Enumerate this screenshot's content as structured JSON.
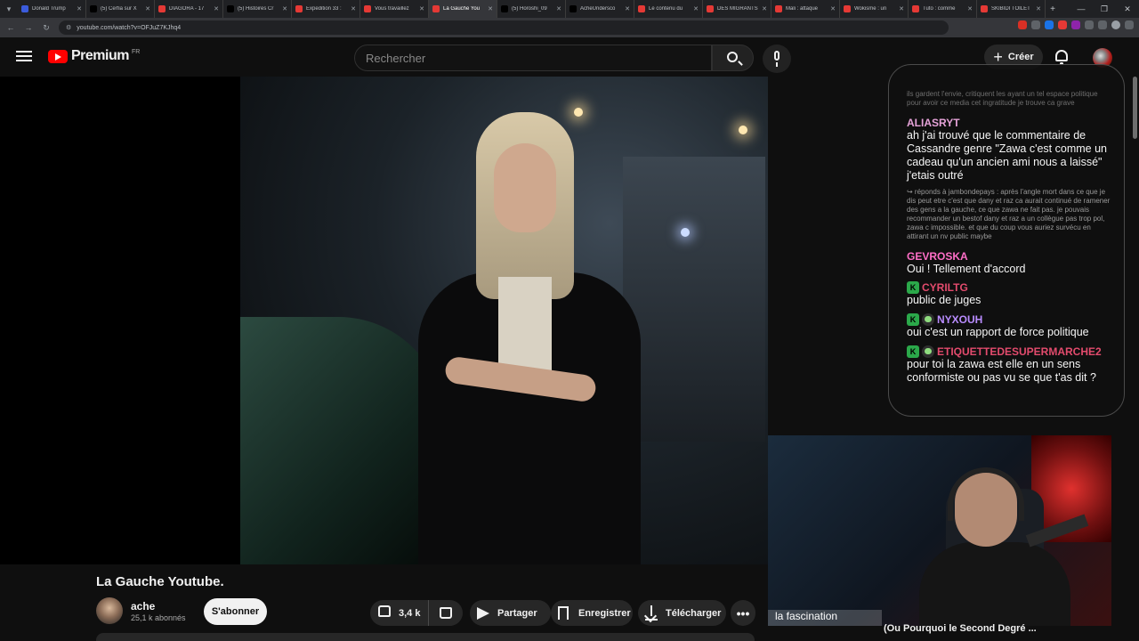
{
  "browser": {
    "tabs": [
      {
        "label": "Donald Trump",
        "color": "#3b5bdb",
        "active": false
      },
      {
        "label": "(5) Cerfia sur X",
        "color": "#000000",
        "active": false
      },
      {
        "label": "DIAGORA - 17",
        "color": "#e53935",
        "active": false
      },
      {
        "label": "(5) Histoires Cr",
        "color": "#000000",
        "active": false
      },
      {
        "label": "Expedition 33 :",
        "color": "#e53935",
        "active": false
      },
      {
        "label": "Vous travaillez",
        "color": "#e53935",
        "active": false
      },
      {
        "label": "La Gauche You",
        "color": "#e53935",
        "active": true
      },
      {
        "label": "(5) Horoshi_09",
        "color": "#000000",
        "active": false
      },
      {
        "label": "AcheUndersco",
        "color": "#000000",
        "active": false
      },
      {
        "label": "Le contenu du",
        "color": "#e53935",
        "active": false
      },
      {
        "label": "DES MIGRANTS",
        "color": "#e53935",
        "active": false
      },
      {
        "label": "Mali : attaque",
        "color": "#e53935",
        "active": false
      },
      {
        "label": "Wokisme : un",
        "color": "#e53935",
        "active": false
      },
      {
        "label": "Tuto : comme",
        "color": "#e53935",
        "active": false
      },
      {
        "label": "SKIBIDI TOILET",
        "color": "#e53935",
        "active": false
      }
    ],
    "url": "youtube.com/watch?v=OFJuZ7KJhq4"
  },
  "header": {
    "logo_text": "Premium",
    "country": "FR",
    "search_placeholder": "Rechercher",
    "create_label": "Créer"
  },
  "chat": {
    "faded_text": "ils gardent l'envie, critiquent les ayant un tel espace politique pour avoir ce media cet ingratitude je trouve ca grave",
    "messages": [
      {
        "user": "ALIASRYT",
        "color": "#e6a3d9",
        "badges": [],
        "text": "ah j'ai trouvé que le commentaire de Cassandre genre \"Zawa c'est comme un cadeau qu'un ancien ami nous a laissé\" j'etais outré"
      },
      {
        "user": "GEVROSKA",
        "color": "#ff6ec7",
        "badges": [],
        "text": "Oui ! Tellement d'accord"
      },
      {
        "user": "CYRILTG",
        "color": "#e34b6d",
        "badges": [
          "K"
        ],
        "text": "public de juges"
      },
      {
        "user": "NYXOUH",
        "color": "#b98cff",
        "badges": [
          "K",
          "skull"
        ],
        "text": "oui c'est un rapport de force politique"
      },
      {
        "user": "ETIQUETTEDESUPERMARCHE2",
        "color": "#e34b6d",
        "badges": [
          "K",
          "skull"
        ],
        "text": "pour toi la zawa est elle en un sens conformiste ou pas vu se que t'as dit ?"
      }
    ],
    "reply_text": "↪ réponds à jambondepays : après l'angle mort dans ce que je dis peut etre c'est que dany et raz ca aurait continué de ramener des gens a la gauche, ce que zawa ne fait pas. je pouvais recommander un bestof dany et raz a un collègue pas trop pol, zawa c impossible. et que du coup vous auriez survécu en attirant un nv public maybe"
  },
  "webcam": {
    "caption": "la fascination",
    "up_next": "(Ou Pourquoi le Second Degré ..."
  },
  "video": {
    "title": "La Gauche Youtube.",
    "channel": "ache",
    "subscribers": "25,1 k abonnés",
    "subscribe_label": "S'abonner",
    "likes": "3,4 k",
    "share_label": "Partager",
    "save_label": "Enregistrer",
    "download_label": "Télécharger",
    "more_label": "•••"
  }
}
